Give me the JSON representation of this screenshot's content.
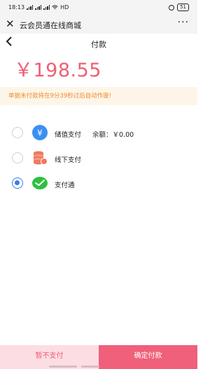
{
  "status_bar": {
    "time": "18:13",
    "battery": "51",
    "network": "HD"
  },
  "wechat_bar": {
    "title": "云会员通在线商城",
    "close_icon": "close-icon",
    "more_icon": "more-icon"
  },
  "nav": {
    "title": "付款",
    "back_icon": "back-chevron-icon"
  },
  "amount": "￥198.55",
  "notice": "单据未付款将在9分39秒过后自动作废!",
  "payment_methods": [
    {
      "label": "储值支付",
      "balance": "余额：￥0.00",
      "icon": "stored-value-yen-icon",
      "icon_color": "#3b8ff3",
      "selected": false
    },
    {
      "label": "线下支付",
      "icon": "offline-coins-icon",
      "icon_color": "#ef7a5f",
      "selected": false
    },
    {
      "label": "支付通",
      "icon": "wechat-pay-icon",
      "icon_color": "#2fc03f",
      "selected": true
    }
  ],
  "footer": {
    "cancel_label": "暂不支付",
    "confirm_label": "确定付款"
  },
  "colors": {
    "accent": "#f0607a",
    "accent_light": "#fcdde4",
    "notice_text": "#ee8a2d",
    "notice_bg": "#fdf6e8",
    "radio_selected": "#3a7de6"
  }
}
